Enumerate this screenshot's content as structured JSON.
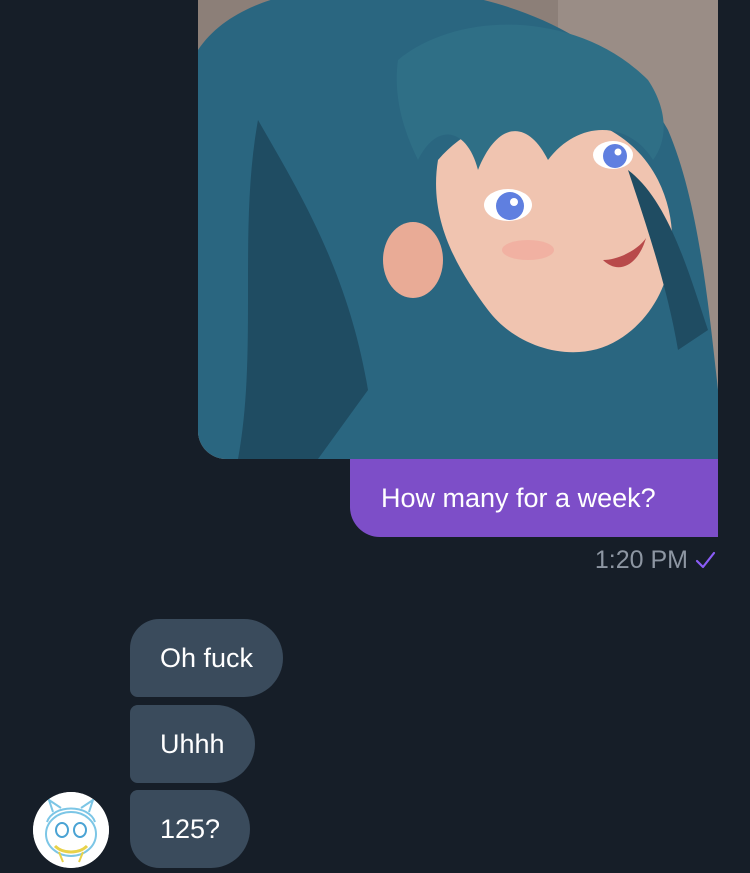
{
  "sent": {
    "image": {
      "alt": "anime-girl-image",
      "colors": {
        "background": "#8c7f78",
        "hair": "#2f6f86",
        "hair_dark": "#1f4c62",
        "skin": "#f0c4b0",
        "eyes": "#5f7fe0"
      }
    },
    "message": "How many for a week?",
    "time": "1:20 PM",
    "status_icon": "checkmark-icon",
    "bubble_color": "#7d4ec8"
  },
  "received": {
    "messages": [
      "Oh fuck",
      "Uhhh",
      "125?"
    ],
    "bubble_color": "#3a4b5c",
    "avatar_icon": "avatar-icon"
  },
  "theme": {
    "background": "#161e28",
    "meta_color": "#8d96a2",
    "check_color": "#8a5cf6"
  }
}
